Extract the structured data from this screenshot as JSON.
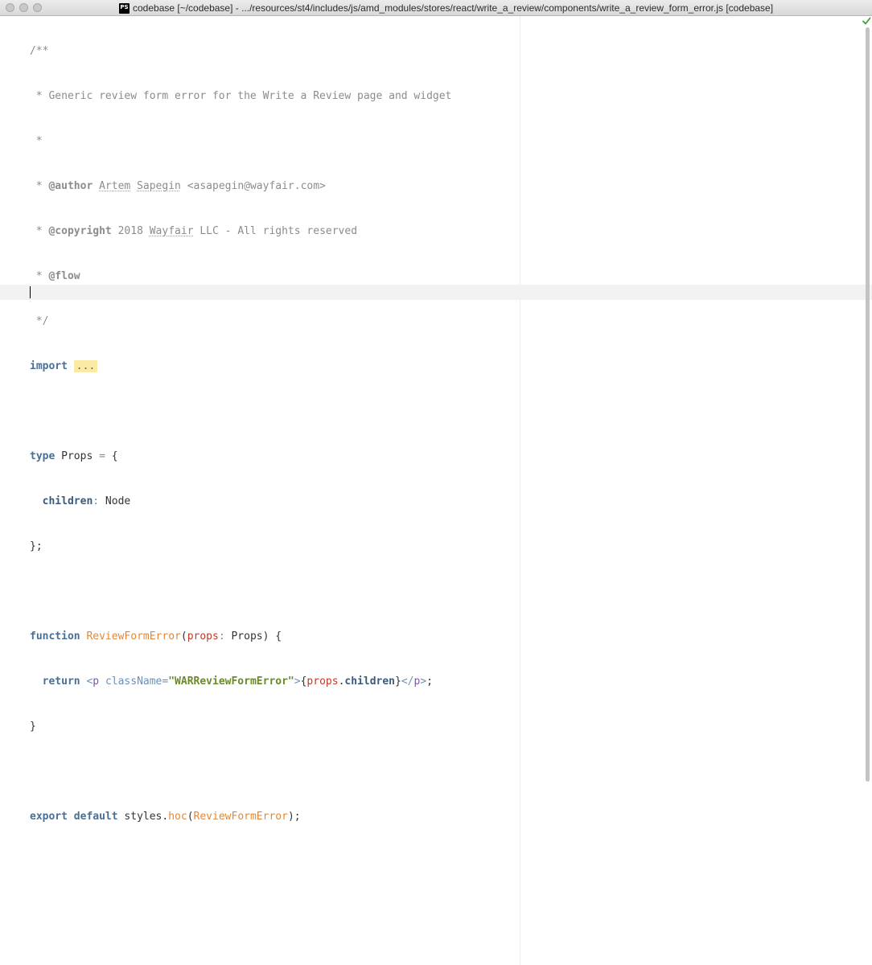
{
  "window": {
    "app_icon_text": "PS",
    "title": "codebase [~/codebase] - .../resources/st4/includes/js/amd_modules/stores/react/write_a_review/components/write_a_review_form_error.js [codebase]"
  },
  "editor": {
    "inspection_status_icon": "check-icon",
    "lines": {
      "l1": {
        "a": "/**"
      },
      "l2": {
        "a": " * Generic review form error for the Write a Review page and widget"
      },
      "l3": {
        "a": " *"
      },
      "l4": {
        "a": " * ",
        "tag": "@author",
        "b": " ",
        "c": "Artem",
        "d": " ",
        "e": "Sapegin",
        "f": " <asapegin@wayfair.com>"
      },
      "l5": {
        "a": " * ",
        "tag": "@copyright",
        "b": " 2018 ",
        "c": "Wayfair",
        "d": " LLC - All rights reserved"
      },
      "l6": {
        "a": " * ",
        "tag": "@flow"
      },
      "l7": {
        "a": " */"
      },
      "l8": {
        "kw": "import",
        "sp": " ",
        "fold": "..."
      },
      "l10": {
        "kw": "type",
        "a": " Props ",
        "op": "=",
        "b": " {"
      },
      "l11": {
        "indent": "  ",
        "prop": "children",
        "op": ":",
        "a": " Node"
      },
      "l12": {
        "a": "};"
      },
      "l14": {
        "kw": "function",
        "sp": " ",
        "fn": "ReviewFormError",
        "p1": "(",
        "param": "props",
        "op": ":",
        "a": " Props) {"
      },
      "l15": {
        "indent": "  ",
        "kw": "return",
        "sp": " ",
        "t1": "<",
        "tag": "p",
        "sp2": " ",
        "attr": "className",
        "eq": "=",
        "str": "\"WARReviewFormError\"",
        "t2": ">",
        "b1": "{",
        "obj": "props",
        "dot": ".",
        "prop": "children",
        "b2": "}",
        "t3": "</",
        "tag2": "p",
        "t4": ">",
        "end": ";"
      },
      "l16": {
        "a": "}"
      },
      "l18": {
        "kw1": "export",
        "sp1": " ",
        "kw2": "default",
        "a": " styles.",
        "fn": "hoc",
        "p1": "(",
        "fn2": "ReviewFormError",
        "p2": ");"
      }
    }
  }
}
